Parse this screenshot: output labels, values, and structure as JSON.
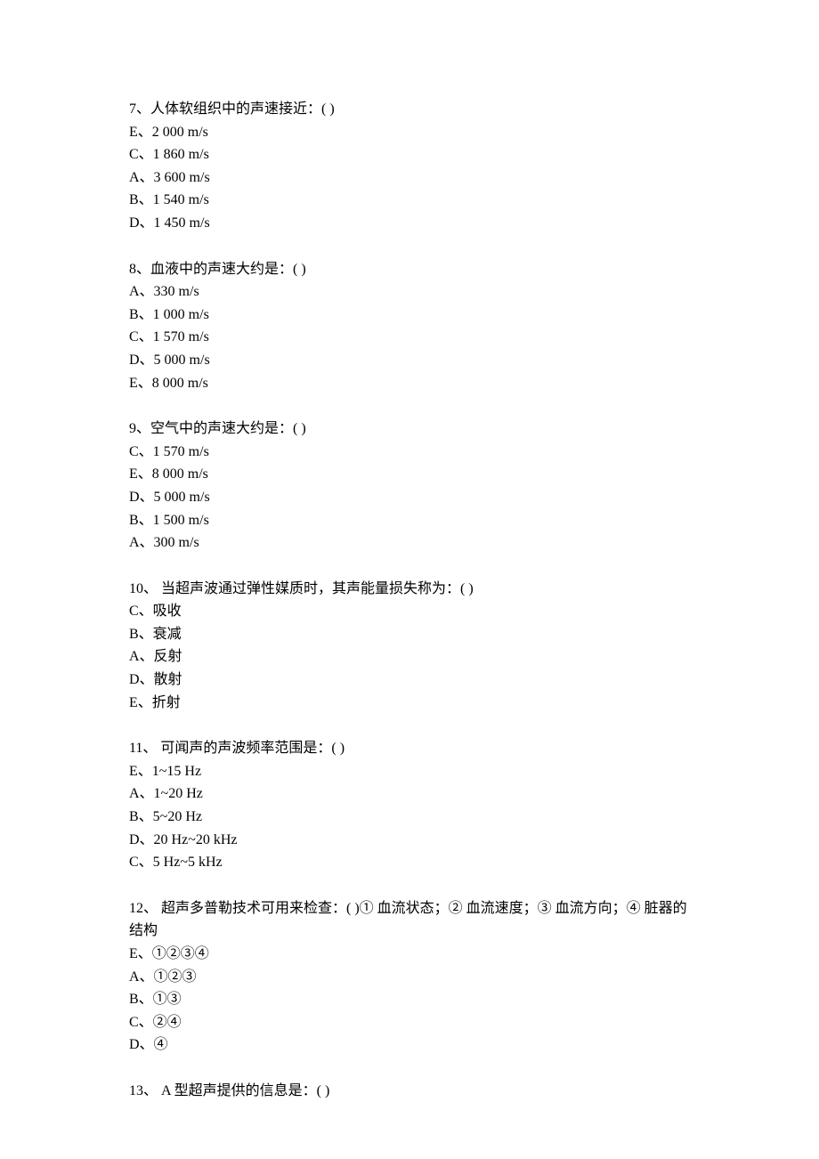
{
  "questions": [
    {
      "number": "7、",
      "text": "人体软组织中的声速接近：( )",
      "options": [
        "E、2 000 m/s",
        "C、1 860 m/s",
        "A、3 600 m/s",
        "B、1 540 m/s",
        "D、1 450 m/s"
      ]
    },
    {
      "number": "8、",
      "text": "血液中的声速大约是：( )",
      "options": [
        "A、330 m/s",
        "B、1 000 m/s",
        "C、1 570 m/s",
        "D、5 000 m/s",
        "E、8 000 m/s"
      ]
    },
    {
      "number": "9、",
      "text": "空气中的声速大约是：( )",
      "options": [
        "C、1 570 m/s",
        "E、8 000 m/s",
        "D、5 000 m/s",
        "B、1 500 m/s",
        "A、300 m/s"
      ]
    },
    {
      "number": "10、",
      "text": " 当超声波通过弹性媒质时，其声能量损失称为：( )",
      "options": [
        "C、吸收",
        "B、衰减",
        "A、反射",
        "D、散射",
        "E、折射"
      ]
    },
    {
      "number": "11、",
      "text": " 可闻声的声波频率范围是：( )",
      "options": [
        "E、1~15 Hz",
        "A、1~20 Hz",
        "B、5~20 Hz",
        "D、20 Hz~20 kHz",
        "C、5 Hz~5 kHz"
      ]
    },
    {
      "number": "12、",
      "text": " 超声多普勒技术可用来检查：( )① 血流状态；② 血流速度；③ 血流方向；④ 脏器的结构",
      "options": [
        "E、①②③④",
        "A、①②③",
        "B、①③",
        "C、②④",
        "D、④"
      ]
    },
    {
      "number": "13、",
      "text": " A 型超声提供的信息是：( )",
      "options": []
    }
  ]
}
